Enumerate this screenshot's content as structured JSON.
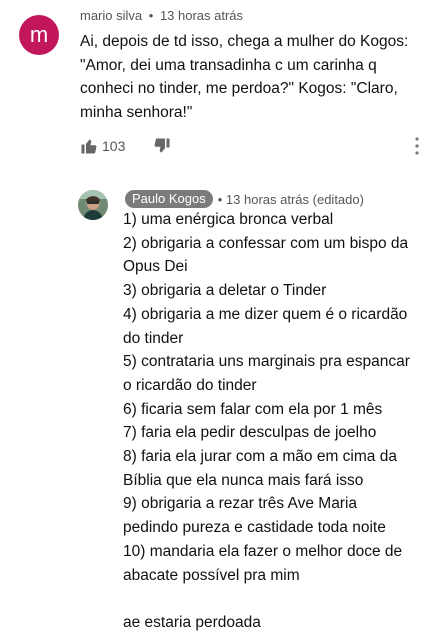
{
  "comment": {
    "avatar_letter": "m",
    "author": "mario silva",
    "separator": "•",
    "timestamp": "13 horas atrás",
    "text": "Ai, depois de td isso, chega a mulher do Kogos: \"Amor, dei uma transadinha c um carinha q conheci no tinder, me perdoa?\" Kogos: \"Claro, minha senhora!\"",
    "like_count": "103",
    "icons": {
      "like": "thumbs-up-icon",
      "dislike": "thumbs-down-icon",
      "more": "more-vert-icon"
    }
  },
  "reply": {
    "author": "Paulo Kogos",
    "separator": "•",
    "timestamp": "13 horas atrás (editado)",
    "lines": [
      "1) uma enérgica bronca verbal",
      "2) obrigaria a confessar com um bispo da",
      "Opus Dei",
      "3) obrigaria a deletar o Tinder",
      "4) obrigaria a me dizer quem é o ricardão",
      "do tinder",
      "5) contrataria uns marginais pra espancar",
      "o ricardão do tinder",
      "6) ficaria sem falar com ela por 1 mês",
      "7) faria ela pedir desculpas de joelho",
      "8) faria ela jurar com a mão em cima da",
      "Bíblia que ela nunca mais fará isso",
      "9) obrigaria a rezar três Ave Maria",
      "pedindo pureza e castidade toda noite",
      "10) mandaria ela fazer o melhor doce de",
      "abacate possível pra mim"
    ],
    "closing": "ae estaria perdoada"
  }
}
